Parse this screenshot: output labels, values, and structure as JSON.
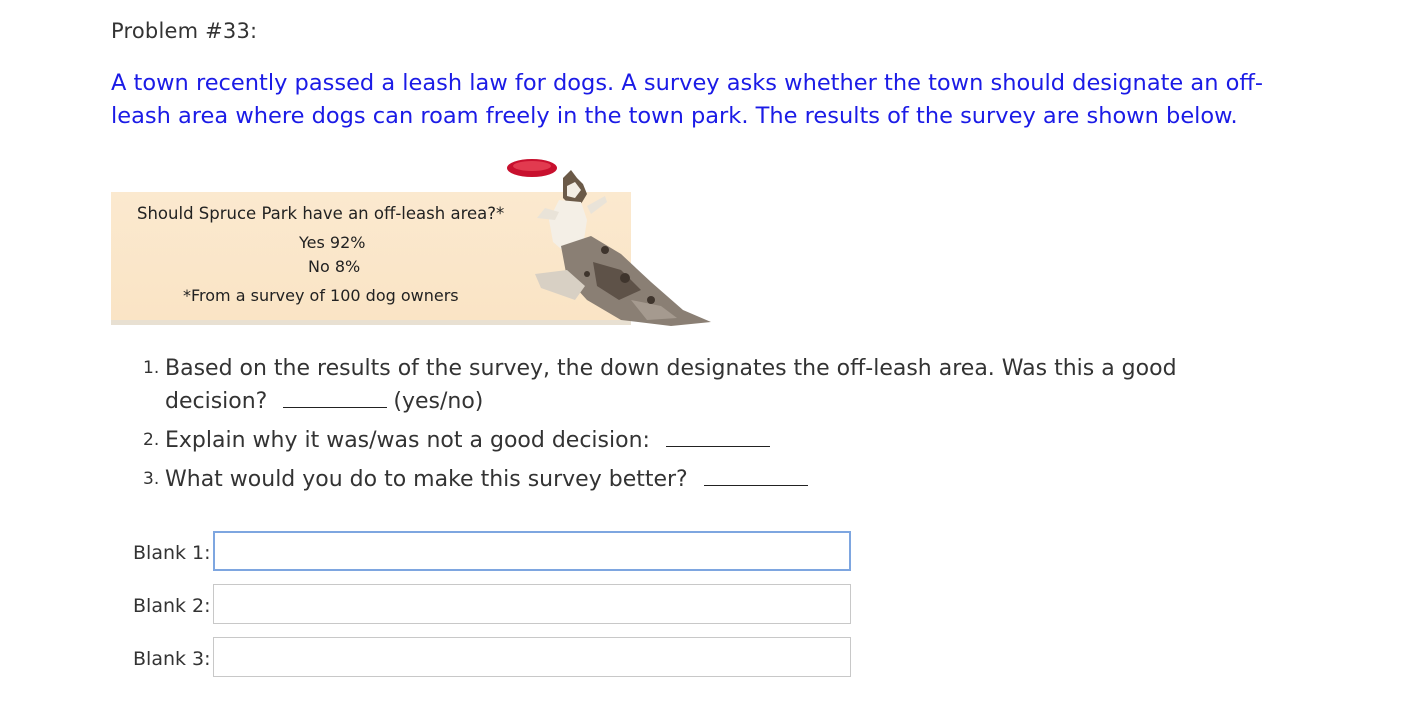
{
  "problem": {
    "title": "Problem #33:",
    "intro": "A town recently passed a leash law for dogs.  A survey asks whether the town should designate an off-leash area where dogs can roam freely in the town park.  The results of the survey are shown below."
  },
  "survey": {
    "question": "Should Spruce Park have an off-leash area?*",
    "yes": "Yes 92%",
    "no": "No 8%",
    "note": "*From a survey of 100 dog owners"
  },
  "questions": [
    {
      "num": "1.",
      "text_a": "Based on the results of the survey, the down designates the off-leash area.  Was this a good",
      "text_b": "decision?",
      "suffix": "(yes/no)"
    },
    {
      "num": "2.",
      "text": "Explain why it was/was not a good decision:"
    },
    {
      "num": "3.",
      "text": "What would you do to make this survey better?"
    }
  ],
  "answers": [
    {
      "label": "Blank 1:",
      "value": ""
    },
    {
      "label": "Blank 2:",
      "value": ""
    },
    {
      "label": "Blank 3:",
      "value": ""
    }
  ],
  "colors": {
    "intro_text": "#1b1be6",
    "panel_bg": "#fbe9cf",
    "input_focus_border": "#7ea6e0",
    "frisbee": "#c8102e"
  },
  "icons": {
    "figure_art": "dog-catching-frisbee"
  }
}
